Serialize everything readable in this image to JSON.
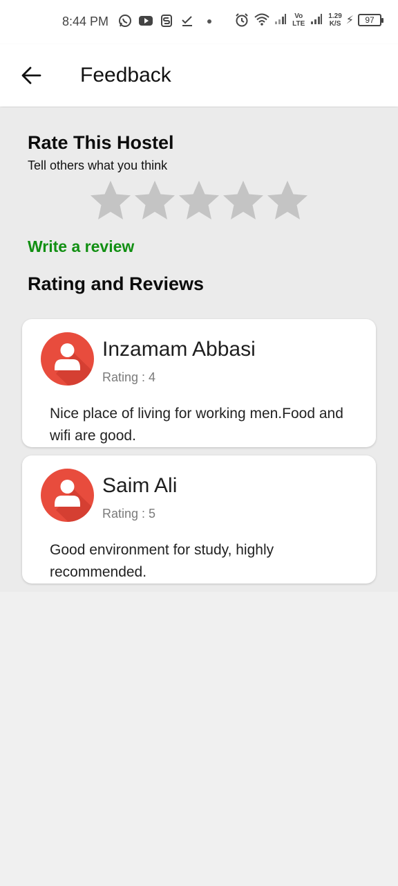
{
  "status_bar": {
    "time": "8:44 PM",
    "icons_left": [
      "whatsapp-icon",
      "youtube-icon",
      "s-app-icon",
      "check-download-icon"
    ],
    "icons_right": [
      "alarm-icon",
      "wifi-icon",
      "signal-icon",
      "volte-icon",
      "signal-icon",
      "network-speed",
      "charging-icon",
      "battery-icon"
    ],
    "volte_top": "Vo",
    "volte_bottom": "LTE",
    "speed_value": "1.29",
    "speed_unit": "K/S",
    "battery": "97"
  },
  "app_bar": {
    "title": "Feedback"
  },
  "rate": {
    "title": "Rate This Hostel",
    "subtitle": "Tell others what you think",
    "stars_total": 5,
    "stars_selected": 0,
    "star_color": "#c4c4c4",
    "write_review": "Write a review"
  },
  "reviews": {
    "heading": "Rating and Reviews",
    "items": [
      {
        "name": "Inzamam Abbasi",
        "rating": "Rating : 4",
        "text": "Nice place of living for working men.Food and wifi are good."
      },
      {
        "name": "Saim Ali",
        "rating": "Rating : 5",
        "text": "Good environment for study, highly recommended."
      }
    ]
  },
  "colors": {
    "accent_green": "#118f12",
    "avatar_red": "#e84c3d",
    "background": "#f0f0f0"
  }
}
